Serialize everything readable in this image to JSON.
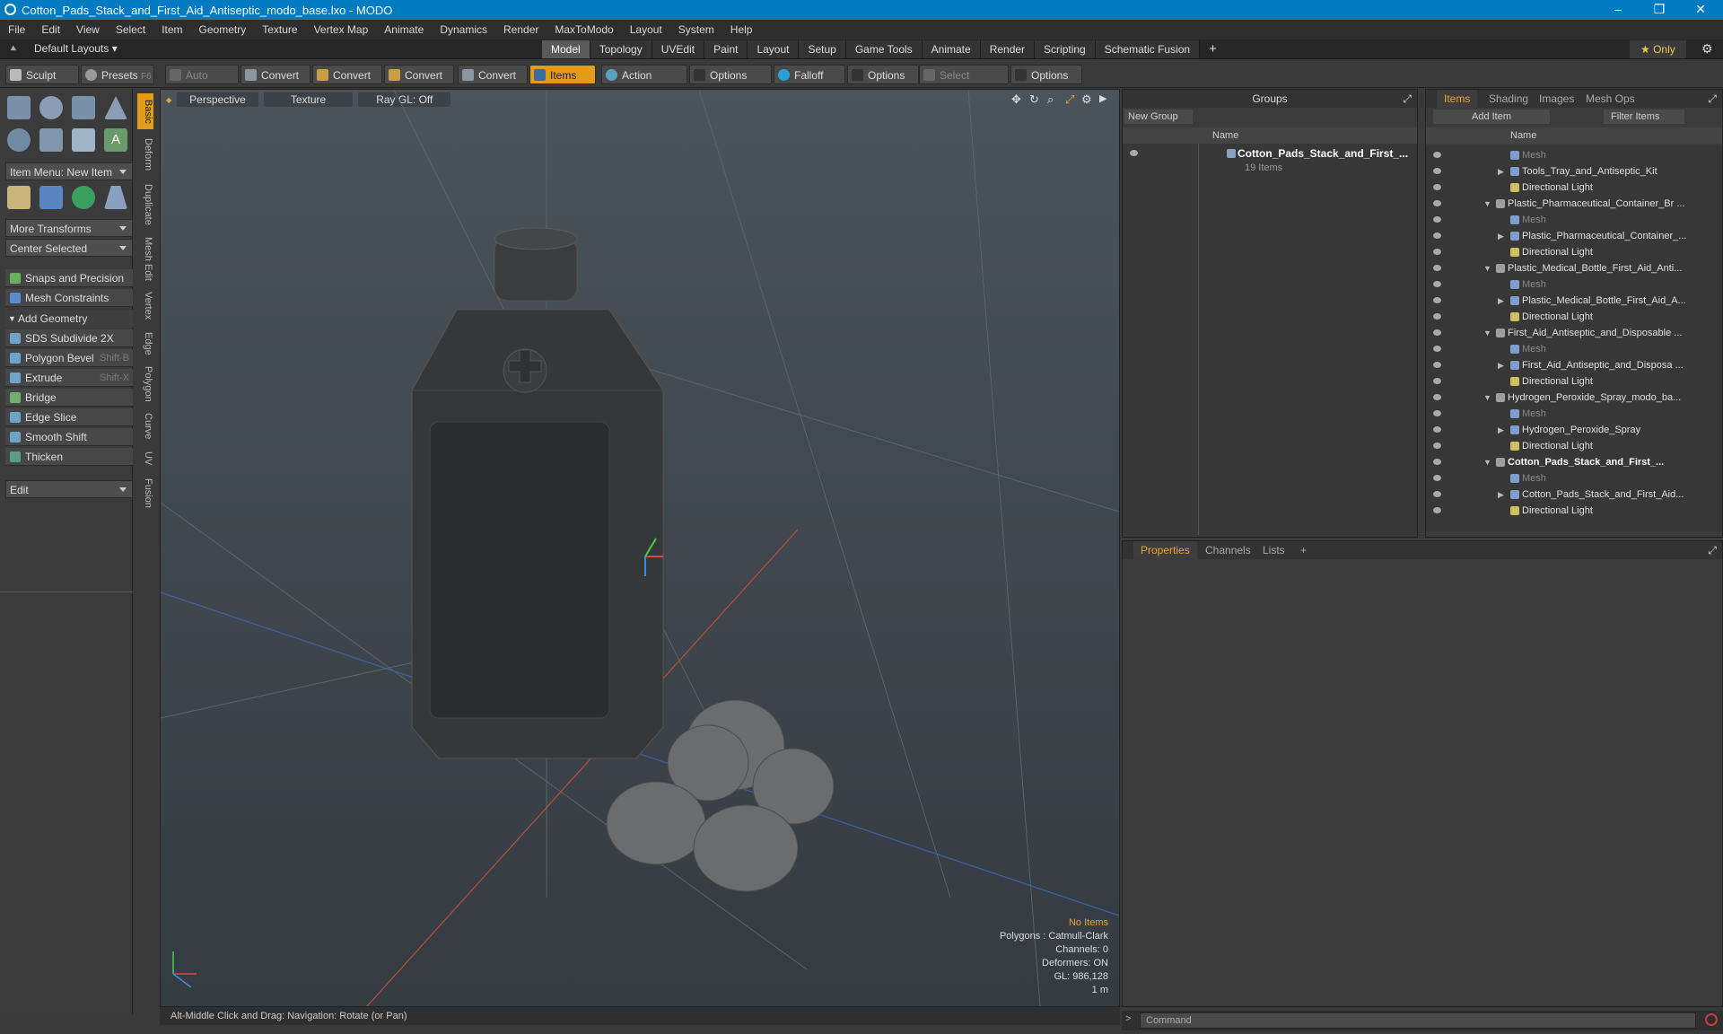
{
  "title": "Cotton_Pads_Stack_and_First_Aid_Antiseptic_modo_base.lxo - MODO",
  "window_buttons": [
    "–",
    "❐",
    "✕"
  ],
  "menu": [
    "File",
    "Edit",
    "View",
    "Select",
    "Item",
    "Geometry",
    "Texture",
    "Vertex Map",
    "Animate",
    "Dynamics",
    "Render",
    "MaxToModo",
    "Layout",
    "System",
    "Help"
  ],
  "layout_selector": "Default Layouts ▾",
  "tabs": [
    "Model",
    "Topology",
    "UVEdit",
    "Paint",
    "Layout",
    "Setup",
    "Game Tools",
    "Animate",
    "Render",
    "Scripting",
    "Schematic Fusion"
  ],
  "tabs_active": "Model",
  "only_label": "★ Only",
  "toolbar": {
    "sculpt": "Sculpt",
    "presets": "Presets",
    "presets_key": "F6",
    "auto_select": "Auto Select",
    "convert": "Convert",
    "items": "Items",
    "action_center": "Action Center",
    "options": "Options",
    "falloff": "Falloff",
    "select_through": "Select Through"
  },
  "left": {
    "item_menu": "Item Menu: New Item",
    "more_transforms": "More Transforms",
    "center_selected": "Center Selected",
    "snaps": "Snaps and Precision",
    "mesh_constraints": "Mesh Constraints",
    "add_geometry": "Add Geometry",
    "tools": [
      {
        "label": "SDS Subdivide 2X",
        "shortcut": ""
      },
      {
        "label": "Polygon Bevel",
        "shortcut": "Shift-B"
      },
      {
        "label": "Extrude",
        "shortcut": "Shift-X"
      },
      {
        "label": "Bridge",
        "shortcut": ""
      },
      {
        "label": "Edge Slice",
        "shortcut": ""
      },
      {
        "label": "Smooth Shift",
        "shortcut": ""
      },
      {
        "label": "Thicken",
        "shortcut": ""
      }
    ],
    "edit": "Edit"
  },
  "vtabs": [
    "Basic",
    "Deform",
    "Duplicate",
    "Mesh Edit",
    "Vertex",
    "Edge",
    "Polygon",
    "Curve",
    "UV",
    "Fusion"
  ],
  "viewport": {
    "perspective": "Perspective",
    "texture": "Texture",
    "raygl": "Ray GL: Off",
    "info": {
      "no_items": "No Items",
      "polygons": "Polygons : Catmull-Clark",
      "channels": "Channels: 0",
      "deformers": "Deformers: ON",
      "gl": "GL: 986,128",
      "scale": "1 m"
    }
  },
  "status": "Alt-Middle Click and Drag:   Navigation: Rotate (or Pan)",
  "groups": {
    "title": "Groups",
    "new_group": "New Group",
    "col_name": "Name",
    "item_name": "Cotton_Pads_Stack_and_First_...",
    "item_count": "19 Items"
  },
  "items_panel": {
    "tabs": [
      "Items",
      "Shading",
      "Images",
      "Mesh Ops"
    ],
    "add_item": "Add Item",
    "filter": "Filter Items",
    "col_name": "Name",
    "rows": [
      {
        "name": "Mesh",
        "indent": 2,
        "kind": "mesh",
        "dim": true
      },
      {
        "name": "Tools_Tray_and_Antiseptic_Kit",
        "indent": 2,
        "kind": "mesh",
        "arrow": "▶"
      },
      {
        "name": "Directional Light",
        "indent": 2,
        "kind": "light"
      },
      {
        "name": "Plastic_Pharmaceutical_Container_Br ...",
        "indent": 1,
        "kind": "scene",
        "arrow": "▼"
      },
      {
        "name": "Mesh",
        "indent": 2,
        "kind": "mesh",
        "dim": true
      },
      {
        "name": "Plastic_Pharmaceutical_Container_...",
        "indent": 2,
        "kind": "mesh",
        "arrow": "▶"
      },
      {
        "name": "Directional Light",
        "indent": 2,
        "kind": "light"
      },
      {
        "name": "Plastic_Medical_Bottle_First_Aid_Anti...",
        "indent": 1,
        "kind": "scene",
        "arrow": "▼"
      },
      {
        "name": "Mesh",
        "indent": 2,
        "kind": "mesh",
        "dim": true
      },
      {
        "name": "Plastic_Medical_Bottle_First_Aid_A...",
        "indent": 2,
        "kind": "mesh",
        "arrow": "▶"
      },
      {
        "name": "Directional Light",
        "indent": 2,
        "kind": "light"
      },
      {
        "name": "First_Aid_Antiseptic_and_Disposable ...",
        "indent": 1,
        "kind": "scene",
        "arrow": "▼"
      },
      {
        "name": "Mesh",
        "indent": 2,
        "kind": "mesh",
        "dim": true
      },
      {
        "name": "First_Aid_Antiseptic_and_Disposa ...",
        "indent": 2,
        "kind": "mesh",
        "arrow": "▶"
      },
      {
        "name": "Directional Light",
        "indent": 2,
        "kind": "light"
      },
      {
        "name": "Hydrogen_Peroxide_Spray_modo_ba...",
        "indent": 1,
        "kind": "scene",
        "arrow": "▼"
      },
      {
        "name": "Mesh",
        "indent": 2,
        "kind": "mesh",
        "dim": true
      },
      {
        "name": "Hydrogen_Peroxide_Spray",
        "indent": 2,
        "kind": "mesh",
        "arrow": "▶"
      },
      {
        "name": "Directional Light",
        "indent": 2,
        "kind": "light"
      },
      {
        "name": "Cotton_Pads_Stack_and_First_...",
        "indent": 1,
        "kind": "scene",
        "arrow": "▼",
        "bold": true
      },
      {
        "name": "Mesh",
        "indent": 2,
        "kind": "mesh",
        "dim": true
      },
      {
        "name": "Cotton_Pads_Stack_and_First_Aid...",
        "indent": 2,
        "kind": "mesh",
        "arrow": "▶"
      },
      {
        "name": "Directional Light",
        "indent": 2,
        "kind": "light"
      }
    ]
  },
  "props": {
    "tabs": [
      "Properties",
      "Channels",
      "Lists"
    ],
    "plus": "+"
  },
  "command_placeholder": "Command"
}
